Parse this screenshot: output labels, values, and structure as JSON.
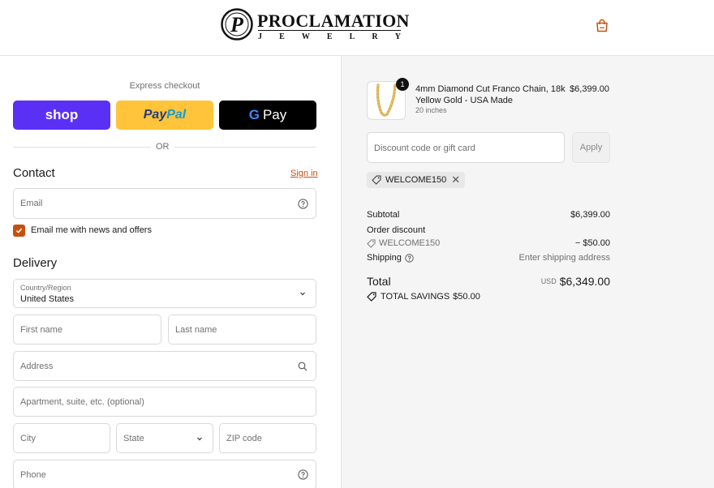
{
  "brand": {
    "name": "PROCLAMATION",
    "subtitle": "JEWELRY",
    "monogram": "P"
  },
  "header": {
    "cart_icon": "shopping-bag-icon",
    "accent": "#c8500f"
  },
  "express": {
    "label": "Express checkout",
    "shop_label": "shop",
    "paypal_part1": "Pay",
    "paypal_part2": "Pal",
    "gpay_g": "G",
    "gpay_label": "Pay",
    "or_label": "OR"
  },
  "contact": {
    "title": "Contact",
    "signin": "Sign in",
    "email_placeholder": "Email",
    "newsletter_label": "Email me with news and offers",
    "newsletter_checked": true
  },
  "delivery": {
    "title": "Delivery",
    "country_label": "Country/Region",
    "country_value": "United States",
    "first_name": "First name",
    "last_name": "Last name",
    "address": "Address",
    "apartment": "Apartment, suite, etc. (optional)",
    "city": "City",
    "state": "State",
    "zip": "ZIP code",
    "phone": "Phone"
  },
  "cart": {
    "item": {
      "name": "4mm Diamond Cut Franco Chain, 18k Yellow Gold - USA Made",
      "variant": "20 inches",
      "price": "$6,399.00",
      "quantity": "1"
    },
    "discount_placeholder": "Discount code or gift card",
    "apply_label": "Apply",
    "applied_code": "WELCOME150"
  },
  "summary": {
    "subtotal_label": "Subtotal",
    "subtotal_value": "$6,399.00",
    "order_discount_label": "Order discount",
    "discount_code": "WELCOME150",
    "discount_value": "− $50.00",
    "shipping_label": "Shipping",
    "shipping_value": "Enter shipping address",
    "total_label": "Total",
    "currency": "USD",
    "total_value": "$6,349.00",
    "savings_label": "TOTAL SAVINGS",
    "savings_value": "$50.00"
  }
}
